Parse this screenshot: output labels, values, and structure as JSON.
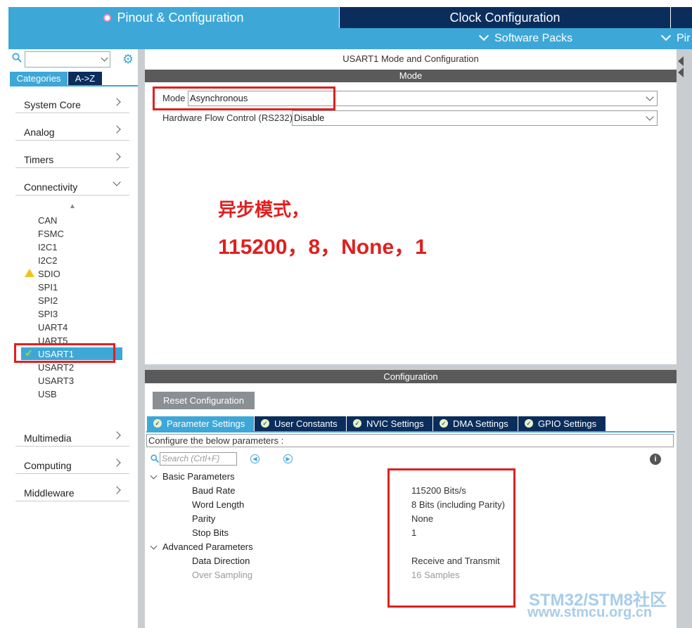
{
  "header": {
    "tabs": [
      {
        "label": "Pinout & Configuration",
        "active": true
      },
      {
        "label": "Clock Configuration",
        "active": false
      }
    ],
    "subtabs": [
      {
        "label": "Software Packs"
      },
      {
        "label": "Pir"
      }
    ]
  },
  "sidebar": {
    "view_tabs": [
      "Categories",
      "A->Z"
    ],
    "categories": [
      {
        "label": "System Core"
      },
      {
        "label": "Analog"
      },
      {
        "label": "Timers"
      },
      {
        "label": "Connectivity",
        "expanded": true
      },
      {
        "label": "Multimedia"
      },
      {
        "label": "Computing"
      },
      {
        "label": "Middleware"
      }
    ],
    "connectivity_items": [
      "CAN",
      "FSMC",
      "I2C1",
      "I2C2",
      "SDIO",
      "SPI1",
      "SPI2",
      "SPI3",
      "UART4",
      "UART5",
      "USART1",
      "USART2",
      "USART3",
      "USB"
    ],
    "selected_item": "USART1",
    "warning_item": "SDIO"
  },
  "panel": {
    "title": "USART1 Mode and Configuration",
    "mode_header": "Mode",
    "mode_label": "Mode",
    "mode_value": "Asynchronous",
    "hfc_label": "Hardware Flow Control (RS232)",
    "hfc_value": "Disable",
    "annotation_line1": "异步模式，",
    "annotation_line2": "115200，8，None，1",
    "config_header": "Configuration",
    "reset_button": "Reset Configuration",
    "param_tabs": [
      "Parameter Settings",
      "User Constants",
      "NVIC Settings",
      "DMA Settings",
      "GPIO Settings"
    ],
    "config_desc": "Configure the below parameters :",
    "search_placeholder": "Search (Crtl+F)",
    "groups": {
      "basic": "Basic Parameters",
      "advanced": "Advanced Parameters"
    },
    "params": [
      {
        "name": "Baud Rate",
        "value": "115200 Bits/s"
      },
      {
        "name": "Word Length",
        "value": "8 Bits (including Parity)"
      },
      {
        "name": "Parity",
        "value": "None"
      },
      {
        "name": "Stop Bits",
        "value": "1"
      },
      {
        "name": "Data Direction",
        "value": "Receive and Transmit"
      },
      {
        "name": "Over Sampling",
        "value": "16 Samples"
      }
    ]
  },
  "watermark": {
    "line1": "STM32/STM8社区",
    "line2": "www.stmcu.org.cn"
  },
  "colors": {
    "accent": "#3da7d8",
    "dark_navy": "#0a2d5c",
    "highlight_red": "#e02020"
  }
}
